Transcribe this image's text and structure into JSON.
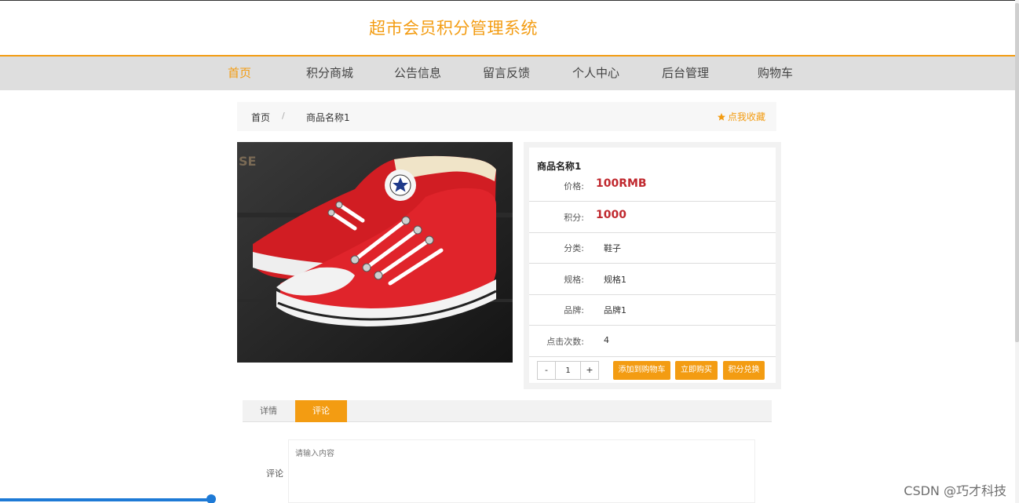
{
  "site": {
    "title": "超市会员积分管理系统"
  },
  "nav": {
    "items": [
      {
        "label": "首页",
        "active": true
      },
      {
        "label": "积分商城"
      },
      {
        "label": "公告信息"
      },
      {
        "label": "留言反馈"
      },
      {
        "label": "个人中心"
      },
      {
        "label": "后台管理"
      },
      {
        "label": "购物车"
      }
    ]
  },
  "breadcrumb": {
    "home": "首页",
    "separator": "/",
    "current": "商品名称1"
  },
  "favorite": {
    "label": "点我收藏",
    "icon": "star-icon"
  },
  "product": {
    "name": "商品名称1",
    "fields": [
      {
        "label": "价格:",
        "value": "100RMB",
        "highlight": true
      },
      {
        "label": "积分:",
        "value": "1000",
        "highlight": true
      },
      {
        "label": "分类:",
        "value": "鞋子"
      },
      {
        "label": "规格:",
        "value": "规格1"
      },
      {
        "label": "品牌:",
        "value": "品牌1"
      },
      {
        "label": "点击次数:",
        "value": "4"
      }
    ],
    "quantity": {
      "minus": "-",
      "value": "1",
      "plus": "+"
    },
    "actions": {
      "add_cart": "添加到购物车",
      "buy_now": "立即购买",
      "redeem": "积分兑换"
    }
  },
  "tabs": [
    {
      "label": "详情"
    },
    {
      "label": "评论",
      "active": true
    }
  ],
  "comment": {
    "label": "评论",
    "placeholder": "请输入内容"
  },
  "watermark": "CSDN @巧才科技",
  "colors": {
    "accent": "#f39c12",
    "price": "#c0282e",
    "nav_bg": "#dedede"
  }
}
